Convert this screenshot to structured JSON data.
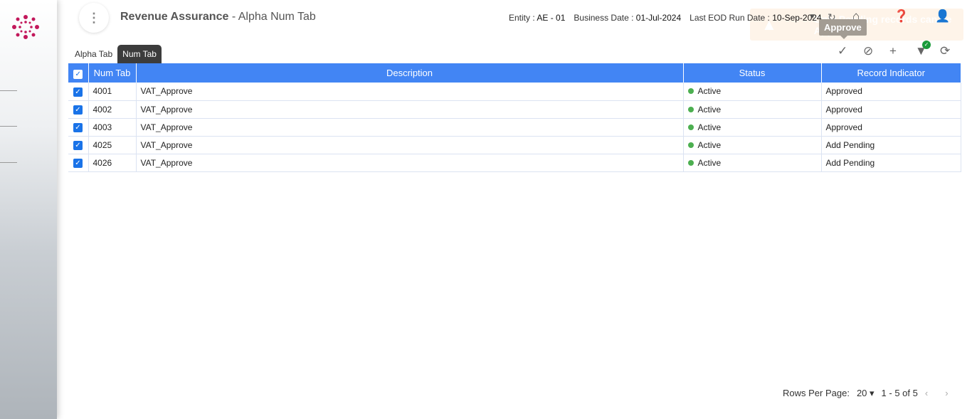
{
  "header": {
    "title": "Revenue Assurance",
    "subtitle": " - Alpha Num Tab",
    "entity_label": "Entity :",
    "entity": "AE - 01",
    "business_date_label": "Business Date :",
    "business_date": "01-Jul-2024",
    "eod_label": "Last EOD Run Date :",
    "eod_date": "10-Sep-2024"
  },
  "toast": {
    "message": "Only Pending records can be Approved"
  },
  "tooltip": "Approve",
  "tabs": [
    {
      "label": "Alpha Tab"
    },
    {
      "label": "Num Tab"
    }
  ],
  "table": {
    "columns": [
      "Num Tab",
      "Description",
      "Status",
      "Record Indicator"
    ],
    "rows": [
      {
        "num": "4001",
        "desc": "VAT_Approve",
        "status": "Active",
        "ind": "Approved"
      },
      {
        "num": "4002",
        "desc": "VAT_Approve",
        "status": "Active",
        "ind": "Approved"
      },
      {
        "num": "4003",
        "desc": "VAT_Approve",
        "status": "Active",
        "ind": "Approved"
      },
      {
        "num": "4025",
        "desc": "VAT_Approve",
        "status": "Active",
        "ind": "Add Pending"
      },
      {
        "num": "4026",
        "desc": "VAT_Approve",
        "status": "Active",
        "ind": "Add Pending"
      }
    ]
  },
  "pager": {
    "rows_label": "Rows Per Page:",
    "rows_value": "20",
    "range": "1 - 5 of 5"
  }
}
